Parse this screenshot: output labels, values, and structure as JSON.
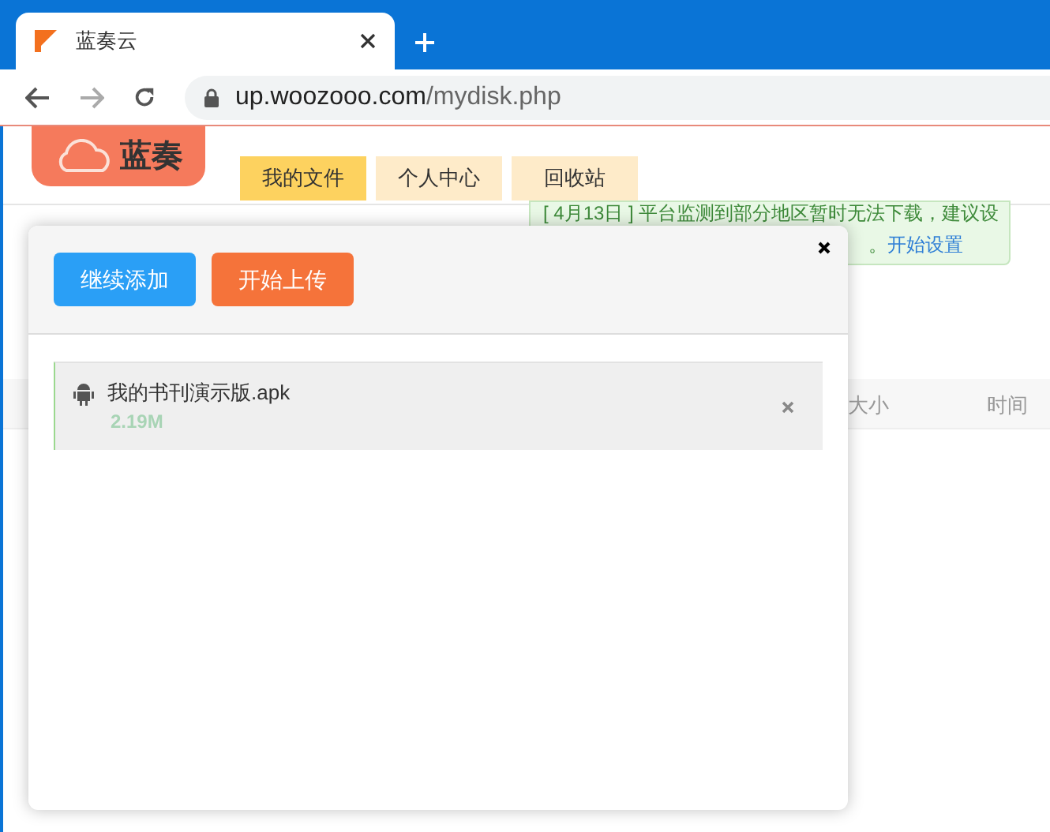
{
  "browser": {
    "tab_title": "蓝奏云",
    "url_host": "up.woozooo.com",
    "url_path": "/mydisk.php"
  },
  "site": {
    "logo_text": "蓝奏",
    "nav": [
      {
        "label": "我的文件",
        "selected": true
      },
      {
        "label": "个人中心",
        "selected": false
      },
      {
        "label": "回收站",
        "selected": false
      }
    ],
    "notice": {
      "line_1": "[ 4月13日 ] 平台监测到部分地区暂时无法下载，建议设",
      "line_2": "。",
      "link": "开始设置"
    },
    "table": {
      "columns": [
        "大小",
        "时间"
      ]
    }
  },
  "upload_dialog": {
    "buttons": [
      {
        "kind": "add",
        "label": "继续添加"
      },
      {
        "kind": "start",
        "label": "开始上传"
      }
    ],
    "files": [
      {
        "name": "我的书刊演示版.apk",
        "size": "2.19M"
      }
    ]
  }
}
